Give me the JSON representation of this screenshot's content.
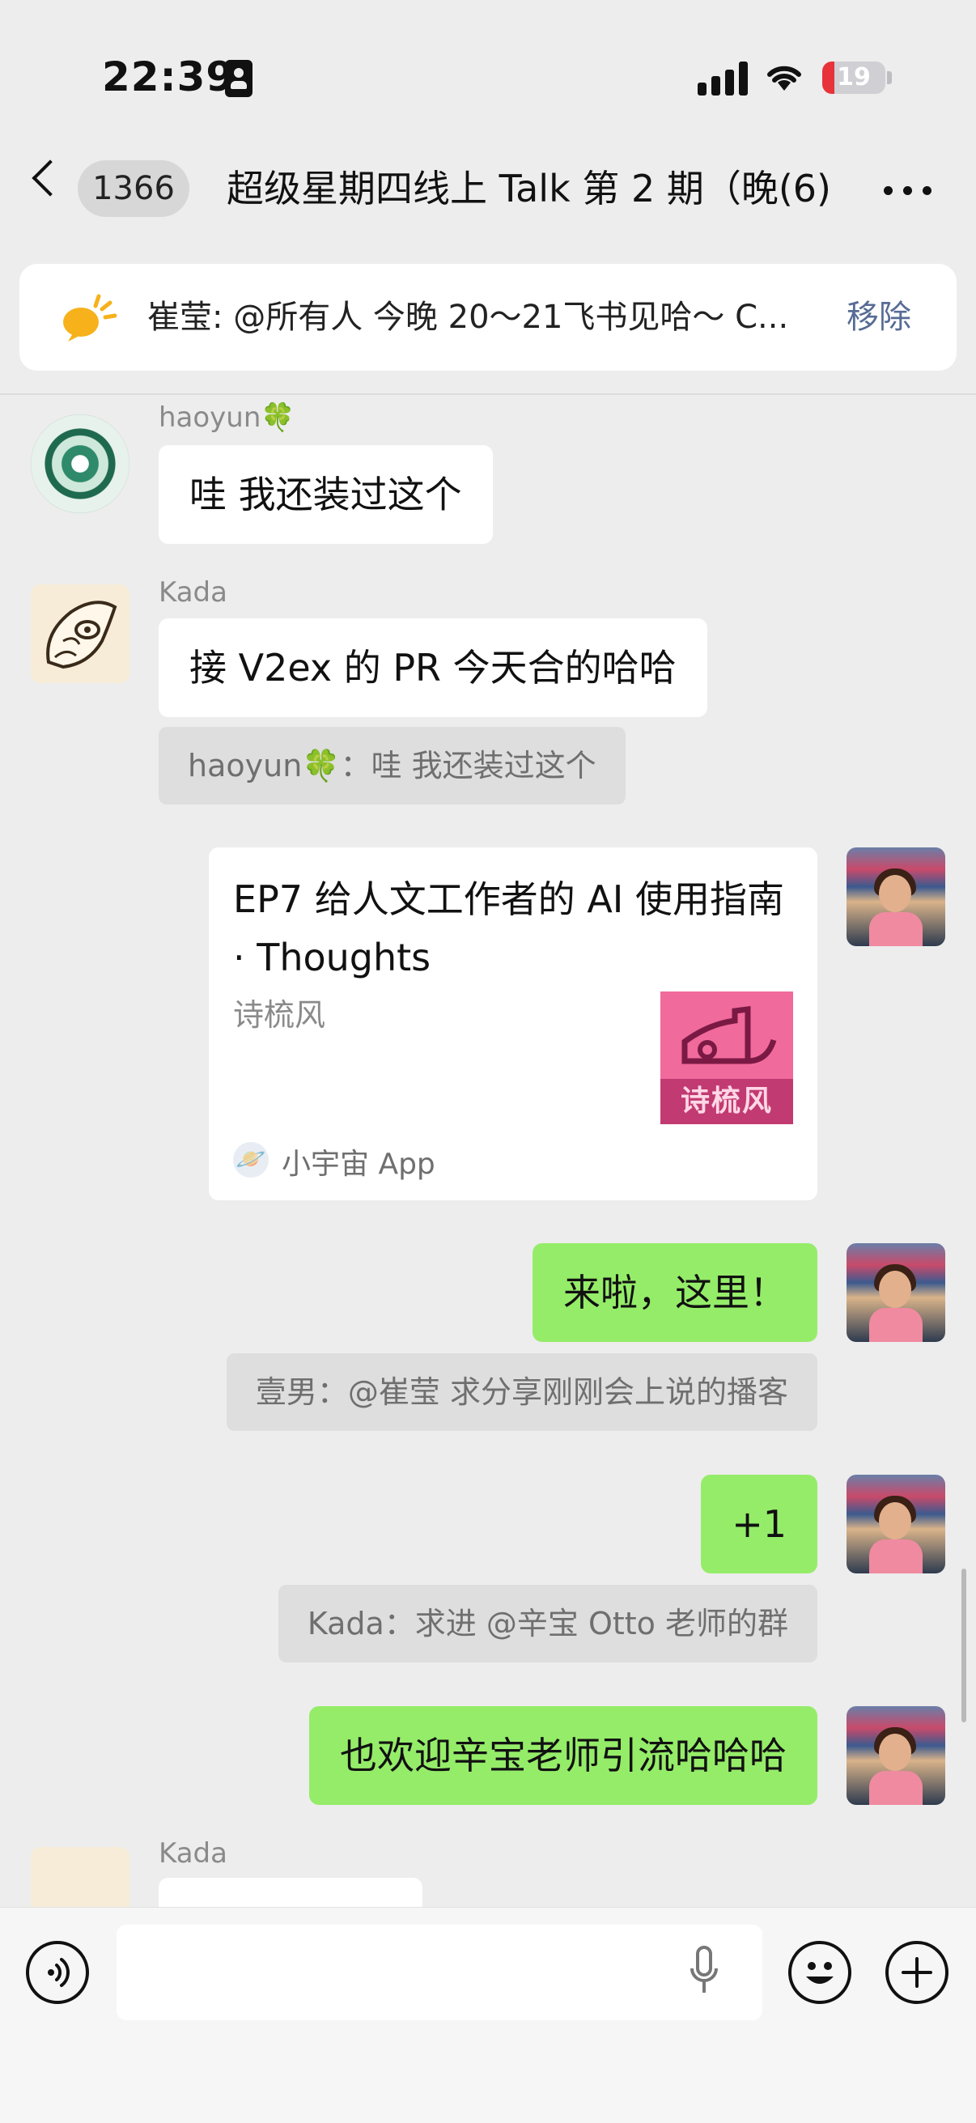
{
  "status_bar": {
    "time": "22:39",
    "battery": "19",
    "battery_fraction": 0.19
  },
  "nav": {
    "unread_badge": "1366",
    "title": "超级星期四线上 Talk 第 2 期（晚(6)"
  },
  "pinned": {
    "text": "崔莹: @所有人 今晚 20～21飞书见哈～ C...",
    "remove_label": "移除"
  },
  "messages": [
    {
      "sender": "haoyun🍀",
      "text": "哇 我还装过这个"
    },
    {
      "sender": "Kada",
      "text": "接 V2ex 的 PR 今天合的哈哈",
      "quote": "haoyun🍀：哇 我还装过这个"
    },
    {
      "card": {
        "title": "EP7 给人文工作者的 AI 使用指南 · Thoughts",
        "subtitle": "诗梳风",
        "thumb_text": "诗梳风",
        "source": "小宇宙 App"
      }
    },
    {
      "text": "来啦，这里！",
      "quote": "壹男：@崔莹 求分享刚刚会上说的播客"
    },
    {
      "text": "+1",
      "quote": "Kada：求进 @辛宝 Otto 老师的群"
    },
    {
      "text": "也欢迎辛宝老师引流哈哈哈"
    },
    {
      "sender": "Kada"
    }
  ],
  "icons": {
    "back": "chevron-left-icon",
    "more": "more-icon",
    "pinned": "announcement-icon",
    "voice": "voice-icon",
    "mic": "mic-icon",
    "emoji": "emoji-icon",
    "plus": "plus-icon"
  }
}
